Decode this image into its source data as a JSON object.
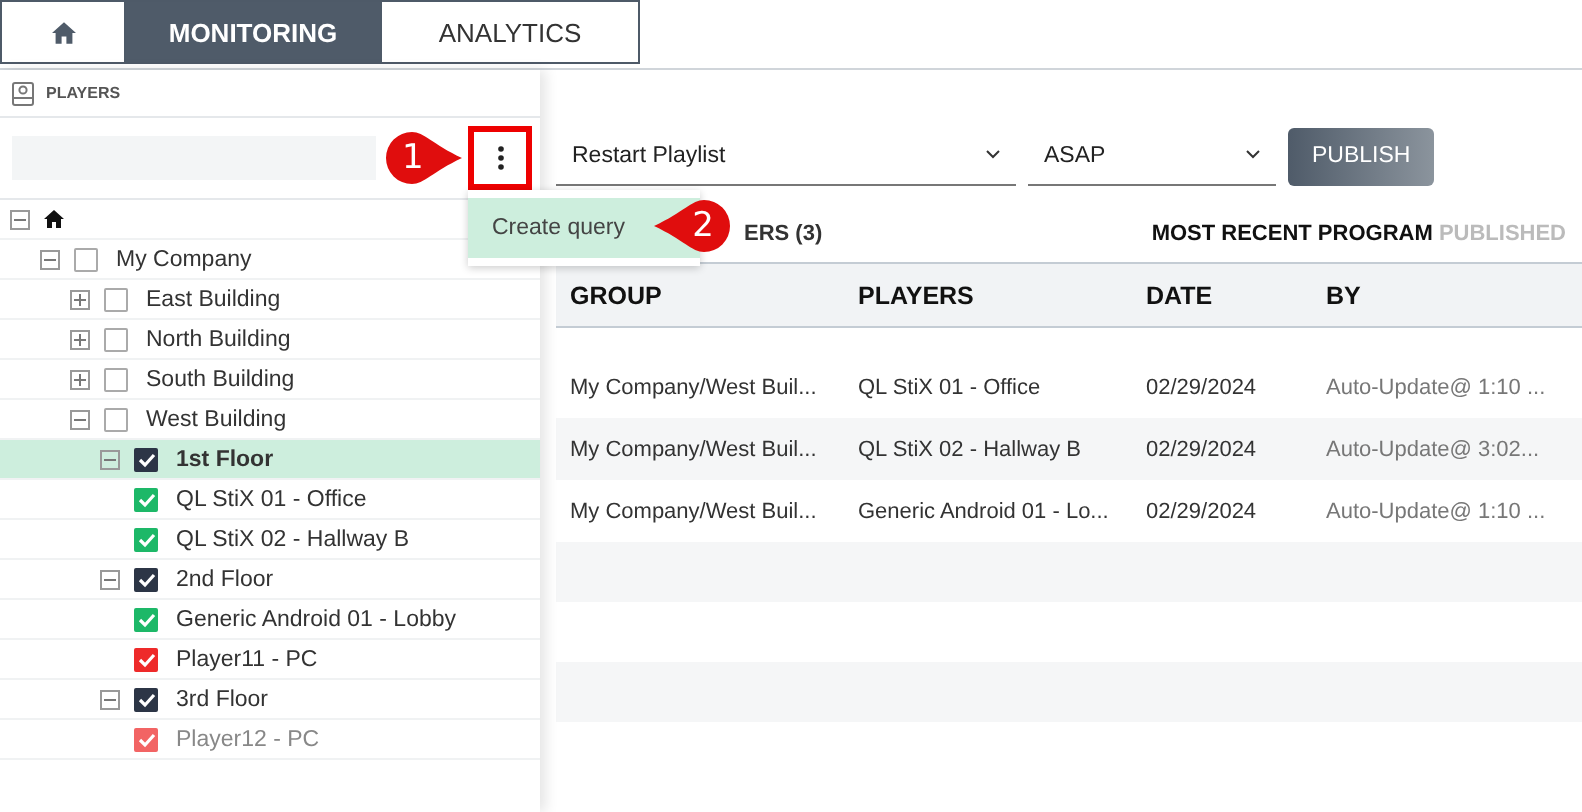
{
  "tabs": [
    {
      "kind": "home",
      "selected": false
    },
    {
      "kind": "text",
      "label": "MONITORING",
      "selected": true
    },
    {
      "kind": "text",
      "label": "ANALYTICS",
      "selected": false
    }
  ],
  "sidebar": {
    "title": "PLAYERS",
    "tree": [
      {
        "kind": "root",
        "expanded": true,
        "children": [
          {
            "label": "My Company",
            "expanded": true,
            "checked": false,
            "selected": false,
            "children": [
              {
                "label": "East Building",
                "expanded": false,
                "checked": false,
                "selected": false
              },
              {
                "label": "North Building",
                "expanded": false,
                "checked": false,
                "selected": false
              },
              {
                "label": "South Building",
                "expanded": false,
                "checked": false,
                "selected": false
              },
              {
                "label": "West Building",
                "expanded": true,
                "checked": false,
                "selected": false,
                "children": [
                  {
                    "label": "1st Floor",
                    "expanded": true,
                    "checked": true,
                    "selected": true,
                    "children": [
                      {
                        "kind": "player",
                        "label": "QL StiX 01 - Office",
                        "checked": true,
                        "color": "#1db868",
                        "disabled": false
                      },
                      {
                        "kind": "player",
                        "label": "QL StiX 02 - Hallway B",
                        "checked": true,
                        "color": "#1db868",
                        "disabled": false
                      }
                    ]
                  },
                  {
                    "label": "2nd Floor",
                    "expanded": true,
                    "checked": true,
                    "selected": false,
                    "children": [
                      {
                        "kind": "player",
                        "label": "Generic Android 01 - Lobby",
                        "checked": true,
                        "color": "#1db868",
                        "disabled": false
                      },
                      {
                        "kind": "player",
                        "label": "Player11 - PC",
                        "checked": true,
                        "color": "#ee2a2a",
                        "disabled": false
                      }
                    ]
                  },
                  {
                    "label": "3rd Floor",
                    "expanded": true,
                    "checked": true,
                    "selected": false,
                    "children": [
                      {
                        "kind": "player",
                        "label": "Player12 - PC",
                        "checked": true,
                        "color": "#f26464",
                        "disabled": true
                      }
                    ]
                  }
                ]
              }
            ]
          }
        ]
      }
    ]
  },
  "menu": {
    "items": [
      {
        "label": "Create query",
        "selected": true
      }
    ]
  },
  "callouts": [
    "1",
    "2"
  ],
  "controls": {
    "action": "Restart Playlist",
    "timing": "ASAP",
    "publish": "PUBLISH"
  },
  "section": {
    "players_heading": "ERS (3)",
    "recent_heading": "MOST RECENT PROGRAM",
    "recent_suffix": "PUBLISHED"
  },
  "table": {
    "columns": [
      "GROUP",
      "PLAYERS",
      "DATE",
      "BY"
    ],
    "rows": [
      [
        "My Company/West Buil...",
        "QL StiX 01 - Office",
        "02/29/2024",
        "Auto-Update@ 1:10 ..."
      ],
      [
        "My Company/West Buil...",
        "QL StiX 02 - Hallway B",
        "02/29/2024",
        "Auto-Update@ 3:02..."
      ],
      [
        "My Company/West Buil...",
        "Generic Android 01 - Lo...",
        "02/29/2024",
        "Auto-Update@ 1:10 ..."
      ]
    ]
  }
}
